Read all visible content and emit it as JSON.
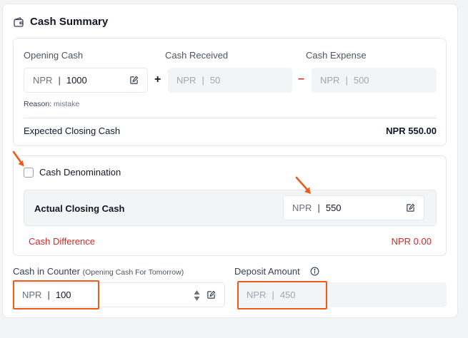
{
  "header": {
    "title": "Cash Summary",
    "icon": "wallet-icon"
  },
  "opening_cash": {
    "label": "Opening Cash",
    "currency": "NPR",
    "value": "1000"
  },
  "cash_received": {
    "label": "Cash Received",
    "currency": "NPR",
    "value": "50"
  },
  "cash_expense": {
    "label": "Cash Expense",
    "currency": "NPR",
    "value": "500"
  },
  "operators": {
    "plus": "+",
    "minus": "–"
  },
  "reason": {
    "label": "Reason:",
    "value": "mistake"
  },
  "expected_closing": {
    "label": "Expected Closing Cash",
    "value": "NPR 550.00"
  },
  "denomination": {
    "label": "Cash Denomination",
    "checked": false
  },
  "actual_closing": {
    "label": "Actual Closing Cash",
    "currency": "NPR",
    "value": "550"
  },
  "difference": {
    "label": "Cash Difference",
    "value": "NPR 0.00"
  },
  "cash_in_counter": {
    "label": "Cash in Counter",
    "sublabel": "(Opening Cash For Tomorrow)",
    "currency": "NPR",
    "value": "100"
  },
  "deposit": {
    "label": "Deposit Amount",
    "currency": "NPR",
    "value": "450",
    "info_icon": "info-icon"
  },
  "sep": "|",
  "colors": {
    "accent": "#f05a16",
    "danger": "#dc2626",
    "muted": "#f3f4f6"
  }
}
